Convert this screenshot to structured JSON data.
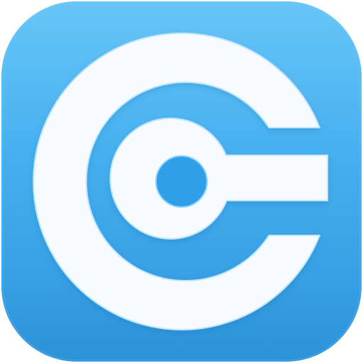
{
  "icon": {
    "name": "app-icon",
    "glyph": "circular-c-keyhole-logo-icon",
    "colors": {
      "tile_top": "#46b8f6",
      "tile_bottom": "#2f9be6",
      "tile_edge": "#2b8fd8",
      "glyph_fill": "#f7fbff",
      "glyph_outline": "#bfe6ff",
      "inner_groove": "#2e9fe8"
    }
  }
}
